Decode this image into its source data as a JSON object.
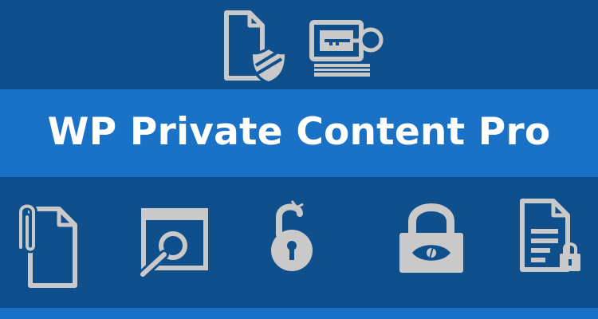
{
  "banner": {
    "title": "WP Private Content Pro",
    "colors": {
      "background": "#0f4f8c",
      "band": "#1a72c7",
      "icon": "#c9c9c9",
      "title_text": "#ffffff"
    },
    "top_icons": [
      "document-shield-icon",
      "monitor-key-icon"
    ],
    "bottom_icons": [
      "attachment-document-icon",
      "window-search-icon",
      "unlocked-padlock-icon",
      "code-padlock-icon",
      "document-lock-icon"
    ]
  }
}
